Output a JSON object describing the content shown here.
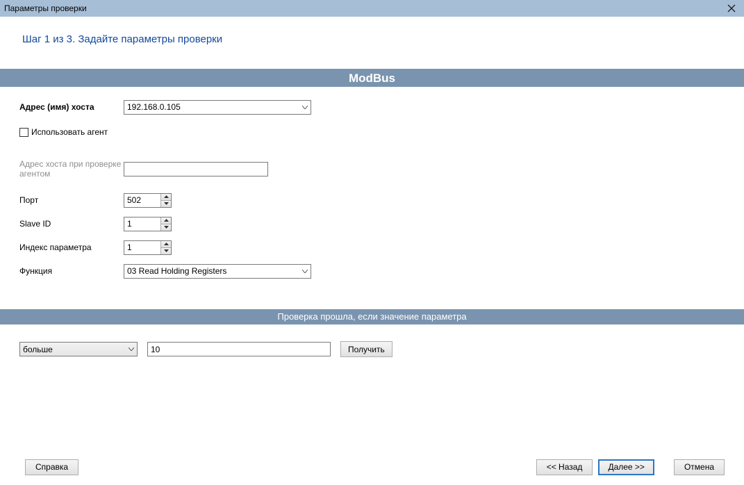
{
  "window": {
    "title": "Параметры проверки"
  },
  "step": {
    "heading": "Шаг 1 из 3. Задайте параметры проверки"
  },
  "section_modbus": {
    "title": "ModBus"
  },
  "labels": {
    "host": "Адрес (имя) хоста",
    "use_agent": "Использовать агент",
    "agent_host": "Адрес хоста при проверке агентом",
    "port": "Порт",
    "slave_id": "Slave ID",
    "param_index": "Индекс параметра",
    "function": "Функция"
  },
  "values": {
    "host": "192.168.0.105",
    "agent_host": "",
    "port": "502",
    "slave_id": "1",
    "param_index": "1",
    "function": "03 Read Holding Registers"
  },
  "section_condition": {
    "title": "Проверка прошла, если значение параметра"
  },
  "condition": {
    "operator": "больше",
    "value": "10",
    "get_button": "Получить"
  },
  "footer": {
    "help": "Справка",
    "back": "<< Назад",
    "next": "Далее >>",
    "cancel": "Отмена"
  }
}
